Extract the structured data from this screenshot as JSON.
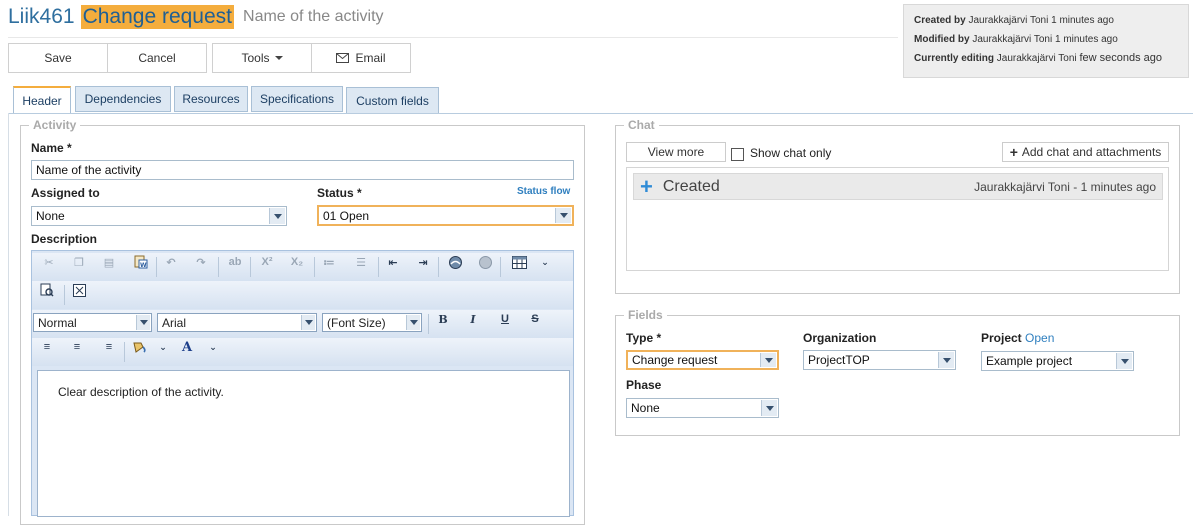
{
  "header": {
    "id": "Liik461",
    "type": "Change request",
    "name": "Name of the activity"
  },
  "info": {
    "created_label": "Created by",
    "created_value": "Jaurakkajärvi Toni 1 minutes ago",
    "modified_label": "Modified by",
    "modified_value": "Jaurakkajärvi Toni 1 minutes ago",
    "editing_label": "Currently editing",
    "editing_user": "Jaurakkajärvi Toni",
    "editing_time": "few seconds ago"
  },
  "toolbar": {
    "save": "Save",
    "cancel": "Cancel",
    "tools": "Tools",
    "email": "Email"
  },
  "tabs": [
    "Header",
    "Dependencies",
    "Resources",
    "Specifications",
    "Custom fields"
  ],
  "activity": {
    "legend": "Activity",
    "name_label": "Name *",
    "name_value": "Name of the activity",
    "assigned_label": "Assigned to",
    "assigned_value": "None",
    "status_label": "Status *",
    "status_flow": "Status flow",
    "status_value": "01 Open",
    "description_label": "Description",
    "format_value": "Normal",
    "font_value": "Arial",
    "size_value": "(Font Size)",
    "description_text": "Clear description of the activity."
  },
  "chat": {
    "legend": "Chat",
    "view_more": "View more",
    "show_chat_only": "Show chat only",
    "add_chat": "Add chat and attachments",
    "entry_title": "Created",
    "entry_meta": "Jaurakkajärvi Toni - 1 minutes ago"
  },
  "fields": {
    "legend": "Fields",
    "type_label": "Type *",
    "type_value": "Change request",
    "org_label": "Organization",
    "org_value": "ProjectTOP",
    "project_label": "Project",
    "project_link": "Open",
    "project_value": "Example project",
    "phase_label": "Phase",
    "phase_value": "None"
  },
  "colors": {
    "accent": "#f4ad3d",
    "link": "#2f7fbf",
    "title_blue": "#2f6f9f"
  }
}
